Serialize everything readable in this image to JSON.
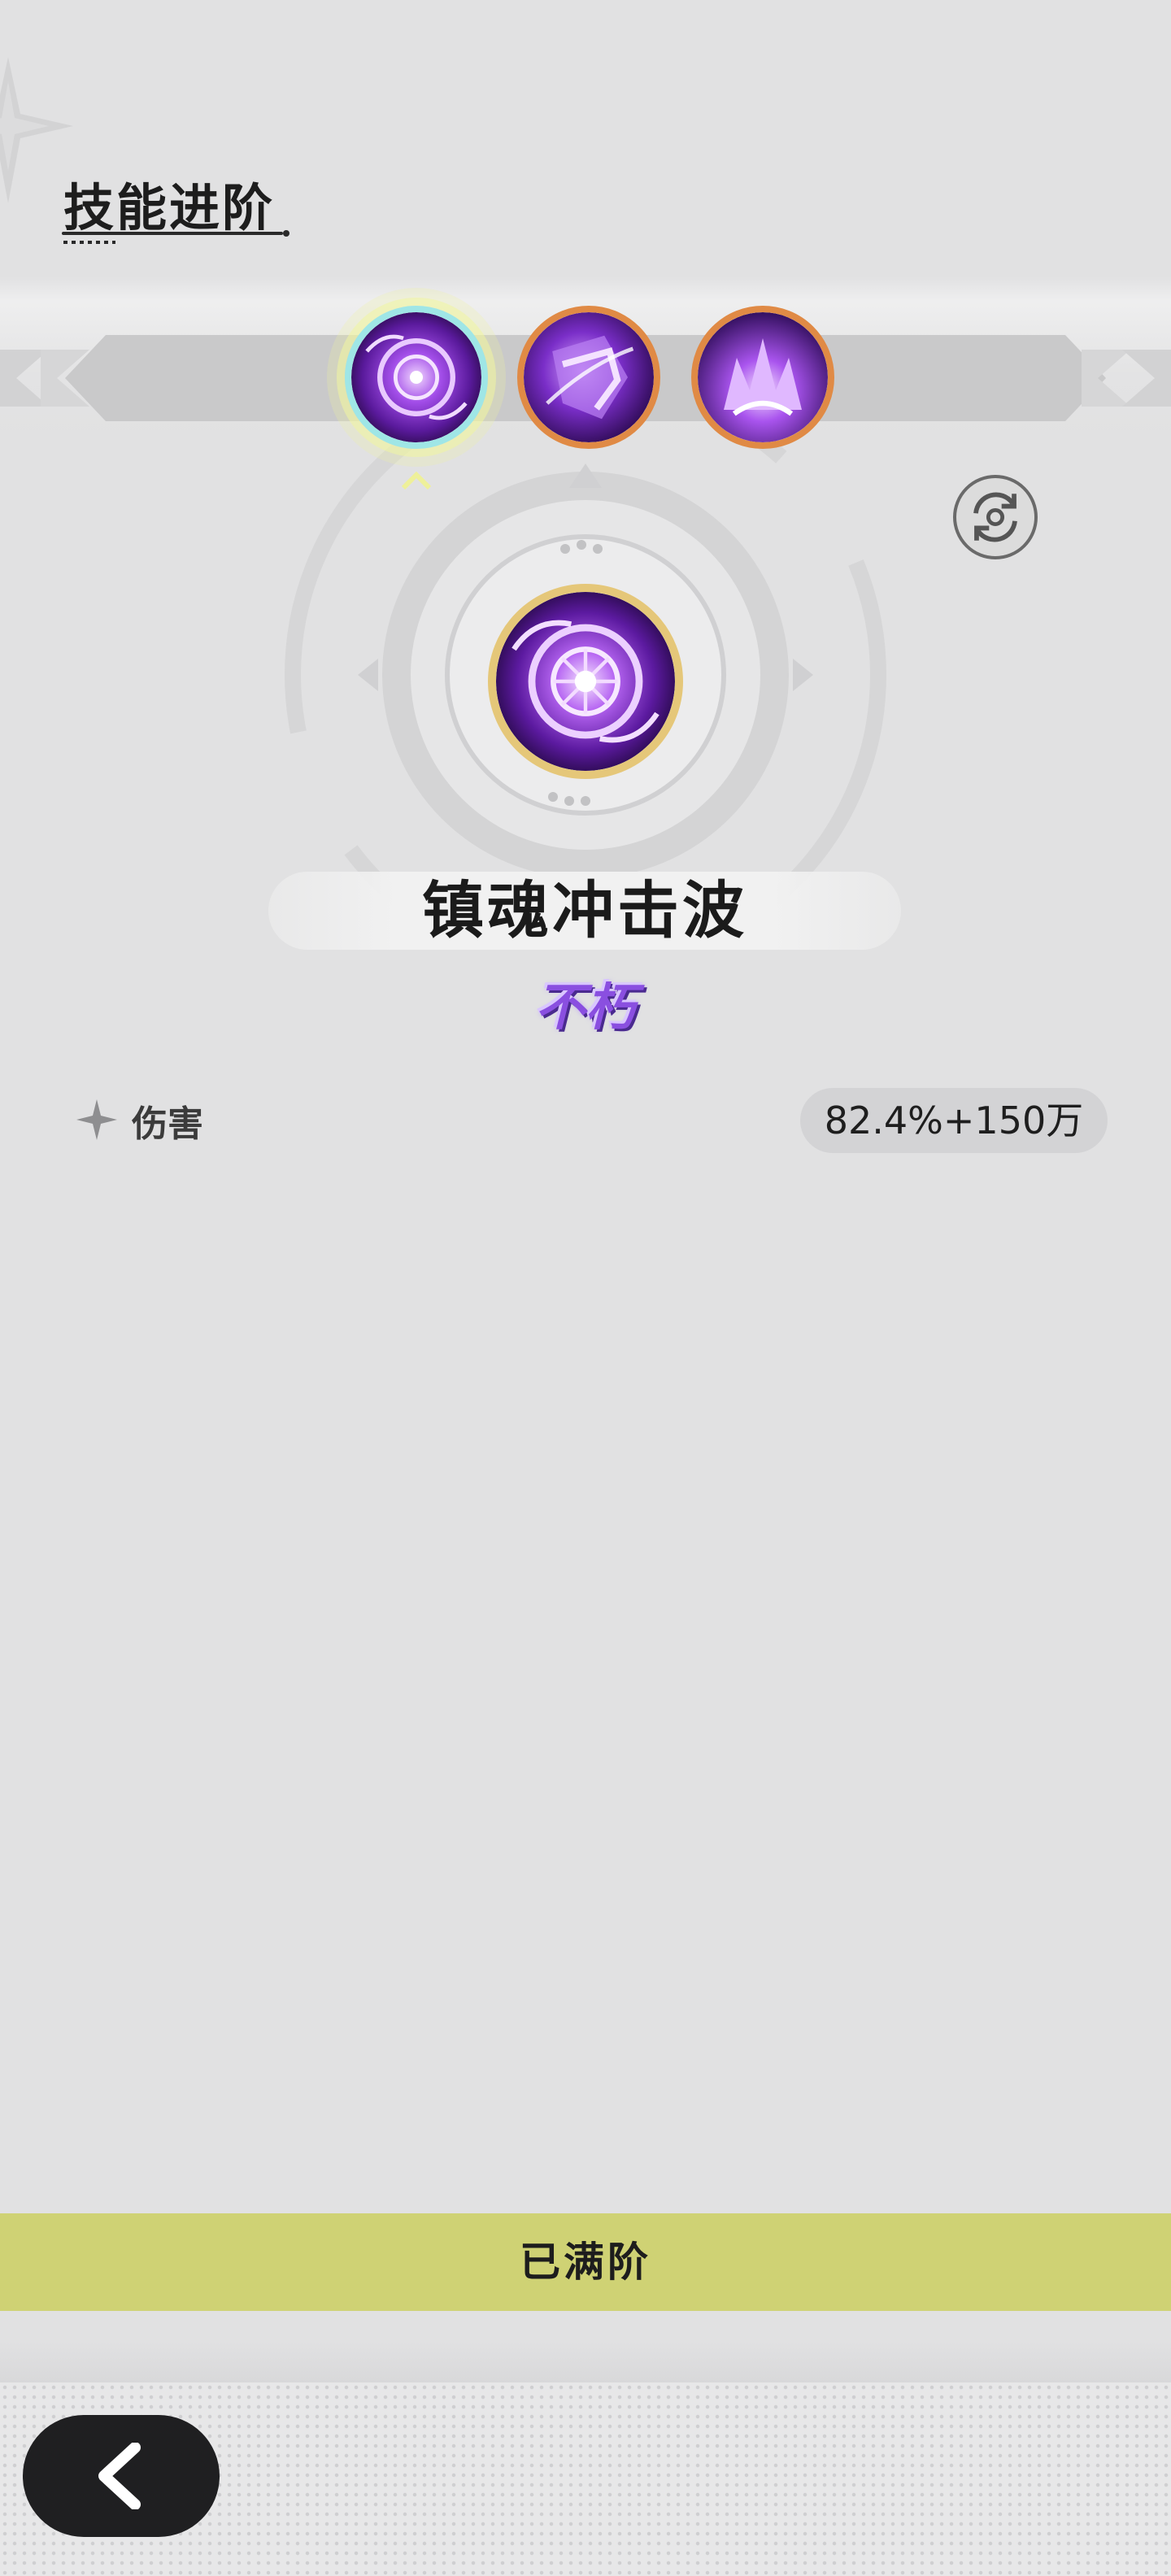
{
  "header": {
    "title": "技能进阶"
  },
  "skills": [
    {
      "icon": "soul-vortex-icon",
      "selected": true
    },
    {
      "icon": "shield-slash-icon",
      "selected": false
    },
    {
      "icon": "violet-flame-icon",
      "selected": false
    }
  ],
  "detail": {
    "name": "镇魂冲击波",
    "rank": "不朽"
  },
  "stats": [
    {
      "icon": "four-point-star-icon",
      "label": "伤害",
      "value": "82.4%+150万"
    }
  ],
  "status": {
    "text": "已满阶"
  },
  "nav": {
    "back_icon": "chevron-left-icon"
  },
  "colors": {
    "background": "#e1e1e2",
    "status_bar": "#cfd274",
    "rank_purple": "#8a4fe0",
    "selected_ring": "#9fe6e6",
    "slot_ring": "#e08a45"
  }
}
